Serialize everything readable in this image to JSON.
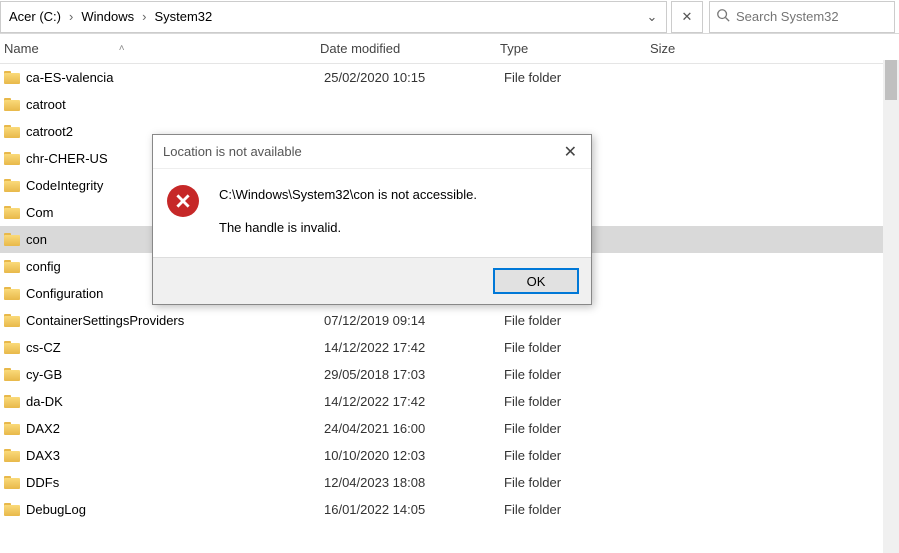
{
  "breadcrumbs": {
    "a": "Acer (C:)",
    "b": "Windows",
    "c": "System32"
  },
  "search": {
    "placeholder": "Search System32"
  },
  "headers": {
    "name": "Name",
    "date": "Date modified",
    "type": "Type",
    "size": "Size"
  },
  "rows": [
    {
      "name": "ca-ES-valencia",
      "date": "25/02/2020 10:15",
      "type": "File folder"
    },
    {
      "name": "catroot",
      "date": "",
      "type": ""
    },
    {
      "name": "catroot2",
      "date": "",
      "type": ""
    },
    {
      "name": "chr-CHER-US",
      "date": "",
      "type": ""
    },
    {
      "name": "CodeIntegrity",
      "date": "",
      "type": ""
    },
    {
      "name": "Com",
      "date": "",
      "type": ""
    },
    {
      "name": "con",
      "date": "",
      "type": ""
    },
    {
      "name": "config",
      "date": "",
      "type": ""
    },
    {
      "name": "Configuration",
      "date": "",
      "type": ""
    },
    {
      "name": "ContainerSettingsProviders",
      "date": "07/12/2019 09:14",
      "type": "File folder"
    },
    {
      "name": "cs-CZ",
      "date": "14/12/2022 17:42",
      "type": "File folder"
    },
    {
      "name": "cy-GB",
      "date": "29/05/2018 17:03",
      "type": "File folder"
    },
    {
      "name": "da-DK",
      "date": "14/12/2022 17:42",
      "type": "File folder"
    },
    {
      "name": "DAX2",
      "date": "24/04/2021 16:00",
      "type": "File folder"
    },
    {
      "name": "DAX3",
      "date": "10/10/2020 12:03",
      "type": "File folder"
    },
    {
      "name": "DDFs",
      "date": "12/04/2023 18:08",
      "type": "File folder"
    },
    {
      "name": "DebugLog",
      "date": "16/01/2022 14:05",
      "type": "File folder"
    }
  ],
  "dialog": {
    "title": "Location is not available",
    "line1": "C:\\Windows\\System32\\con is not accessible.",
    "line2": "The handle is invalid.",
    "ok": "OK"
  }
}
